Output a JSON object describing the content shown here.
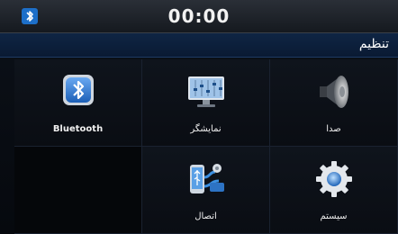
{
  "status": {
    "time": "00:00",
    "bluetooth_icon": "bluetooth-status-icon"
  },
  "header": {
    "title": "تنظیم"
  },
  "menu": {
    "items": [
      {
        "label": "Bluetooth",
        "icon": "bluetooth-icon"
      },
      {
        "label": "نمایشگر",
        "icon": "equalizer-display-icon"
      },
      {
        "label": "صدا",
        "icon": "speaker-icon"
      },
      {
        "label": "اتصال",
        "icon": "phone-usb-connection-icon"
      },
      {
        "label": "سیستم",
        "icon": "gear-icon"
      }
    ]
  },
  "colors": {
    "title_bar": "#0f2544",
    "accent_blue": "#2f7fd6"
  }
}
